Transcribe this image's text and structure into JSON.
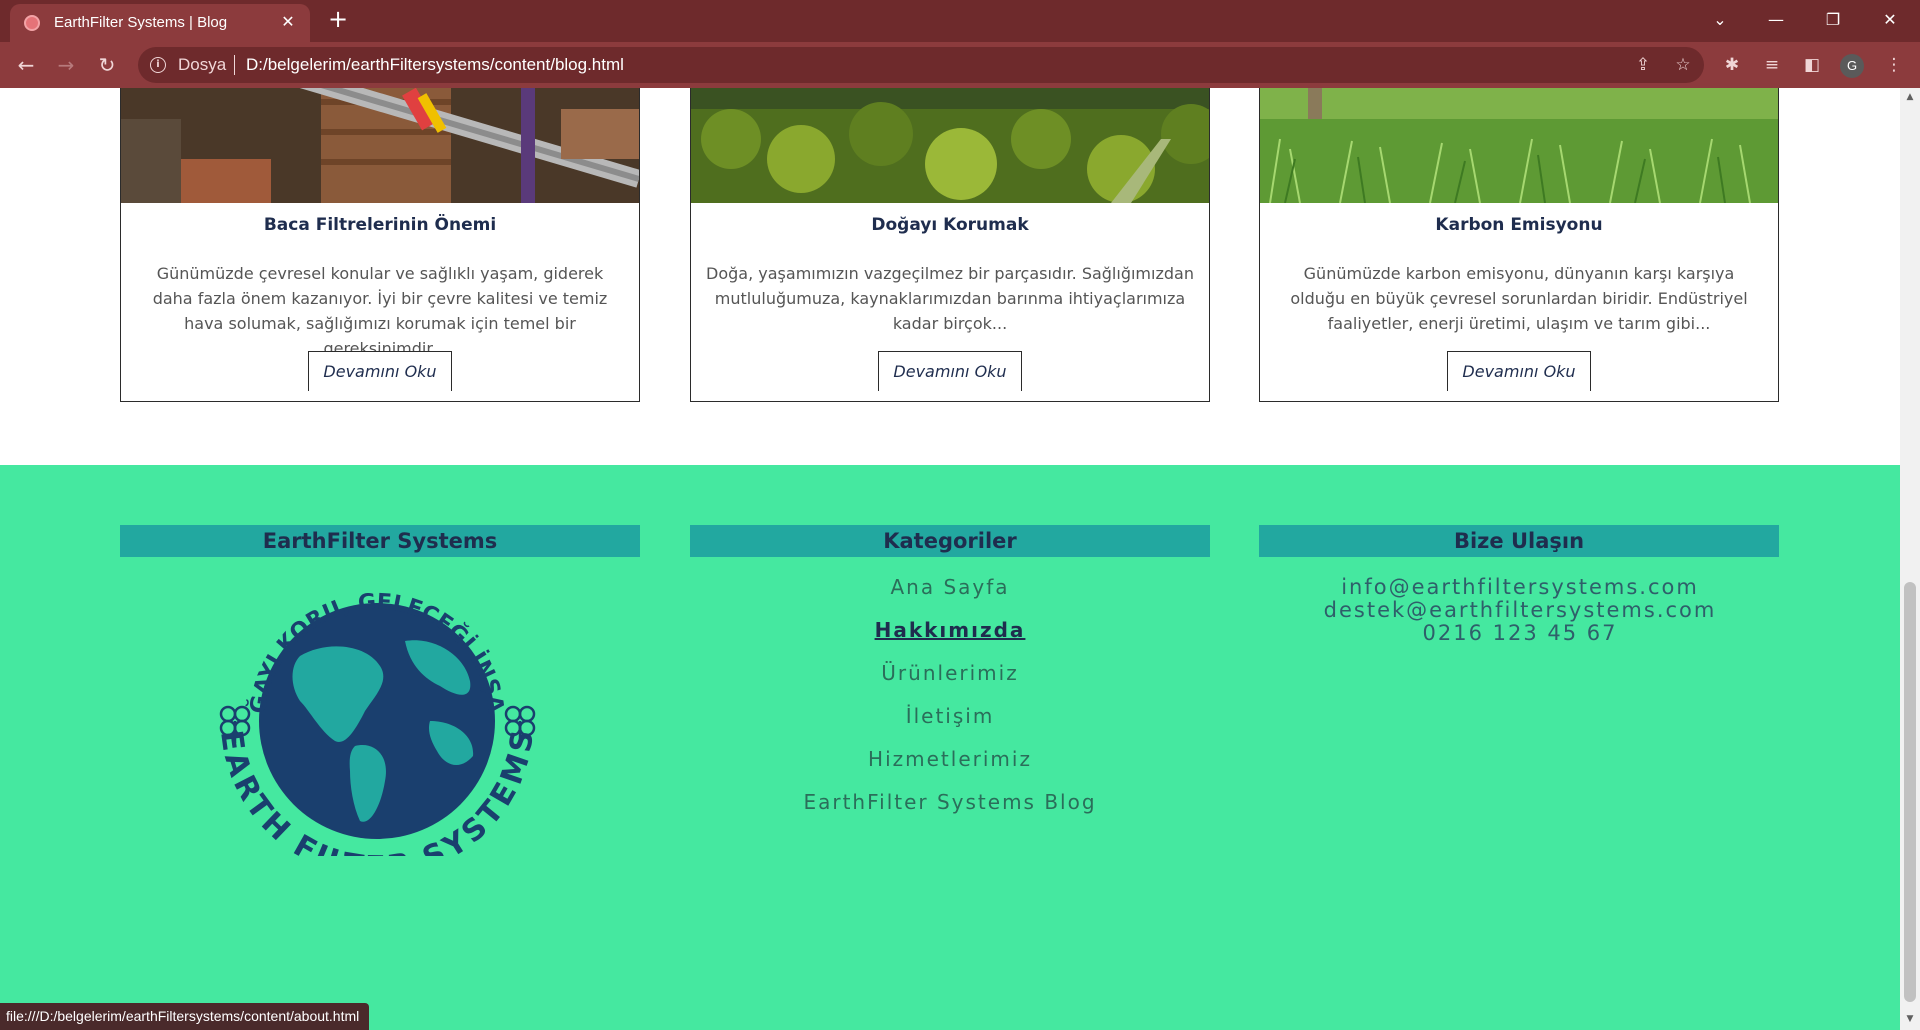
{
  "browser": {
    "tab_title": "EarthFilter Systems | Blog",
    "tab_close": "✕",
    "new_tab": "+",
    "dosya_label": "Dosya",
    "url": "D:/belgelerim/earthFiltersystems/content/blog.html",
    "profile_initial": "G",
    "status_url": "file:///D:/belgelerim/earthFiltersystems/content/about.html"
  },
  "cards": [
    {
      "title": "Baca Filtrelerinin Önemi",
      "text": "Günümüzde çevresel konular ve sağlıklı yaşam, giderek daha fazla önem kazanıyor. İyi bir çevre kalitesi ve temiz hava solumak, sağlığımızı korumak için temel bir gereksinimdir.",
      "button": "Devamını Oku"
    },
    {
      "title": "Doğayı Korumak",
      "text": "Doğa, yaşamımızın vazgeçilmez bir parçasıdır. Sağlığımızdan mutluluğumuza, kaynaklarımızdan barınma ihtiyaçlarımıza kadar birçok...",
      "button": "Devamını Oku"
    },
    {
      "title": "Karbon Emisyonu",
      "text": "Günümüzde karbon emisyonu, dünyanın karşı karşıya olduğu en büyük çevresel sorunlardan biridir. Endüstriyel faaliyetler, enerji üretimi, ulaşım ve tarım gibi...",
      "button": "Devamını Oku"
    }
  ],
  "footer": {
    "brand_heading": "EarthFilter Systems",
    "categories_heading": "Kategoriler",
    "contact_heading": "Bize Ulaşın",
    "logo": {
      "top_text": "DOĞAYI KORU, GELECEĞİ İNŞA ET",
      "bottom_text": "EARTH FILTER SYSTEMS"
    },
    "categories": [
      "Ana Sayfa",
      "Hakkımızda",
      "Ürünlerimiz",
      "İletişim",
      "Hizmetlerimiz",
      "EarthFilter Systems Blog"
    ],
    "contact": [
      "info@earthfiltersystems.com",
      "destek@earthfiltersystems.com",
      "0216 123 45 67"
    ]
  },
  "colors": {
    "browser_frame": "#6e2a2c",
    "footer_bg": "#45e8a0",
    "footer_heading_bg": "#22a8a0",
    "heading_text": "#1f2d4e"
  }
}
